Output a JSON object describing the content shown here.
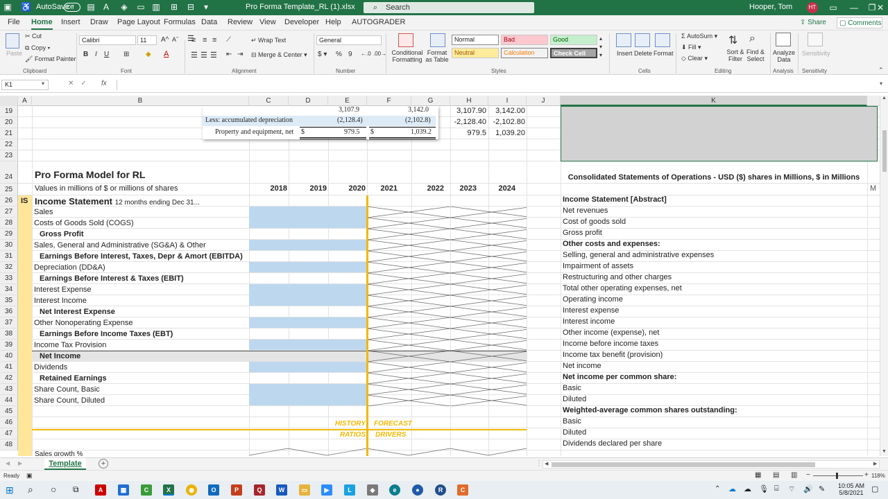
{
  "titlebar": {
    "autosave_label": "AutoSave",
    "autosave_state": "Off",
    "filename": "Pro Forma Template_RL (1).xlsx",
    "search_placeholder": "Search",
    "user_name": "Hooper, Tom",
    "user_initials": "HT"
  },
  "ribbon_tabs": [
    "File",
    "Home",
    "Insert",
    "Draw",
    "Page Layout",
    "Formulas",
    "Data",
    "Review",
    "View",
    "Developer",
    "Help",
    "AUTOGRADER"
  ],
  "share_label": "Share",
  "comments_label": "Comments",
  "ribbon": {
    "clipboard": {
      "paste": "Paste",
      "cut": "Cut",
      "copy": "Copy",
      "format_painter": "Format Painter",
      "group": "Clipboard"
    },
    "font": {
      "name": "Calibri",
      "size": "11",
      "group": "Font"
    },
    "alignment": {
      "wrap": "Wrap Text",
      "merge": "Merge & Center",
      "group": "Alignment"
    },
    "number": {
      "format": "General",
      "group": "Number"
    },
    "styles": {
      "cond": "Conditional Formatting",
      "table": "Format as Table",
      "normal": "Normal",
      "bad": "Bad",
      "good": "Good",
      "neutral": "Neutral",
      "calculation": "Calculation",
      "check": "Check Cell",
      "group": "Styles"
    },
    "cells": {
      "insert": "Insert",
      "delete": "Delete",
      "format": "Format",
      "group": "Cells"
    },
    "editing": {
      "autosum": "AutoSum",
      "fill": "Fill",
      "clear": "Clear",
      "sort": "Sort & Filter",
      "find": "Find & Select",
      "group": "Editing"
    },
    "analysis": {
      "analyze": "Analyze Data",
      "group": "Analysis"
    },
    "sensitivity": {
      "label": "Sensitivity",
      "group": "Sensitivity"
    }
  },
  "formula_bar": {
    "name_box": "K1",
    "fx": "fx"
  },
  "columns": [
    "A",
    "B",
    "C",
    "D",
    "E",
    "F",
    "G",
    "H",
    "I",
    "J",
    "K"
  ],
  "rows": [
    "19",
    "20",
    "21",
    "22",
    "23",
    "24",
    "25",
    "26",
    "27",
    "28",
    "29",
    "30",
    "31",
    "32",
    "33",
    "34",
    "35",
    "36",
    "37",
    "38",
    "39",
    "40",
    "41",
    "42",
    "43",
    "44",
    "45",
    "46",
    "47",
    "48"
  ],
  "inset": {
    "r1_e": "3,107.9",
    "r1_f": "3,142.0",
    "r2_label": "Less: accumulated depreciation",
    "r2_e": "(2,128.4)",
    "r2_f": "(2,102.8)",
    "r3_label": "Property and equipment, net",
    "r3_cur": "$",
    "r3_e": "979.5",
    "r3_cur2": "$",
    "r3_f": "1,039.2"
  },
  "hi_cells": {
    "h19": "3,107.90",
    "i19": "3,142.00",
    "h20": "-2,128.40",
    "i20": "-2,102.80",
    "h21": "979.5",
    "i21": "1,039.20"
  },
  "model": {
    "title": "Pro Forma Model for RL",
    "subtitle": "Values in millions of $ or millions of shares",
    "years": [
      "2018",
      "2019",
      "2020",
      "2021",
      "2022",
      "2023",
      "2024"
    ],
    "is_tag": "IS",
    "section": "Income Statement",
    "period": "12 months ending Dec 31...",
    "lines": [
      "Sales",
      "Costs of Goods Sold (COGS)",
      "Gross Profit",
      "Sales, General and Administrative (SG&A) & Other",
      "Earnings Before Interest, Taxes, Depr & Amort (EBITDA)",
      "Depreciation (DD&A)",
      "Earnings Before Interest & Taxes (EBIT)",
      "Interest Expense",
      "Interest Income",
      "Net Interest Expense",
      "Other Nonoperating Expense",
      "Earnings Before Income Taxes (EBT)",
      "Income Tax Provision",
      "Net Income",
      "Dividends",
      "Retained Earnings",
      "Share Count, Basic",
      "Share Count, Diluted"
    ],
    "history_label": "HISTORY",
    "forecast_label": "FORECAST",
    "ratios_label": "RATIOS",
    "drivers_label": "DRIVERS",
    "row49_partial": "Sales growth %"
  },
  "statement": {
    "heading": "Consolidated Statements of Operations - USD ($) shares in Millions, $ in Millions",
    "col_next": "M",
    "items": [
      "Income Statement [Abstract]",
      "Net revenues",
      "Cost of goods sold",
      "Gross profit",
      "Other costs and expenses:",
      "Selling, general and administrative expenses",
      "Impairment of assets",
      "Restructuring and other charges",
      "Total other operating expenses, net",
      "Operating income",
      "Interest expense",
      "Interest income",
      "Other income (expense), net",
      "Income before income taxes",
      "Income tax benefit (provision)",
      "Net income",
      "Net income per common share:",
      "Basic",
      "Diluted",
      "Weighted-average common shares outstanding:",
      "Basic",
      "Diluted",
      "Dividends declared per share"
    ]
  },
  "sheet_tab": "Template",
  "status": {
    "ready": "Ready",
    "zoom": "118%"
  },
  "clock": {
    "time": "10:05 AM",
    "date": "5/8/2021"
  },
  "colors": {
    "excel_green": "#217346",
    "gold": "#f2b800",
    "input_blue": "#bdd7ee",
    "gray_fill": "#d9d9d9",
    "tag_yellow": "#ffe699"
  }
}
